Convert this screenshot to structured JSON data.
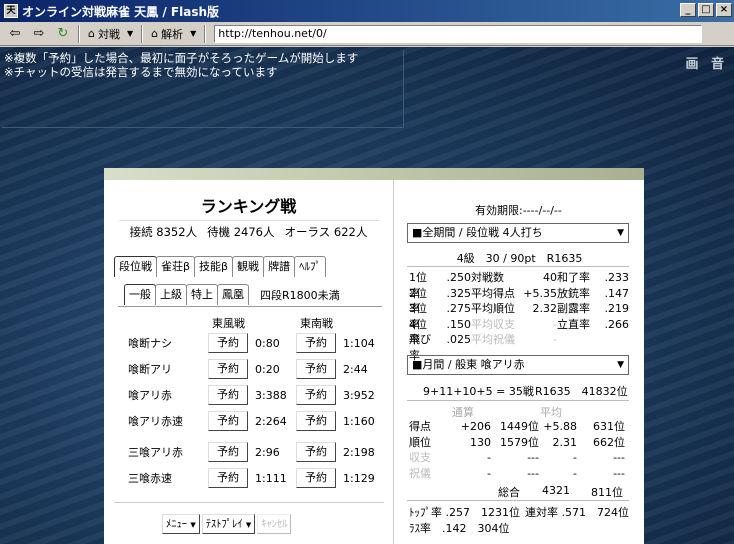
{
  "window": {
    "title": "オンライン対戦麻雀 天鳳 / Flash版",
    "buttons": [
      "_",
      "□",
      "×"
    ]
  },
  "toolbar": {
    "taisen": "対戦",
    "kaiseki": "解析",
    "url": "http://tenhou.net/0/"
  },
  "chat": {
    "line1": "※複数「予約」した場合、最初に面子がそろったゲームが開始します",
    "line2": "※チャットの受信は発言するまで無効になっています"
  },
  "corner": "画 音",
  "lobby": {
    "title": "ランキング戦",
    "connected": "接続 8352人",
    "waiting": "待機 2476人",
    "allLast": "オーラス 622人",
    "tabs": [
      "段位戦",
      "雀荘β",
      "技能β",
      "観戦",
      "牌譜",
      "ﾍﾙﾌﾟ"
    ],
    "subtabs": [
      "一般",
      "上級",
      "特上",
      "鳳凰"
    ],
    "rankReq": "四段R1800未満",
    "col_east": "東風戦",
    "col_south": "東南戦",
    "reserve": "予約",
    "rows": [
      {
        "name": "喰断ナシ",
        "east": "0:80",
        "south": "1:104"
      },
      {
        "name": "喰断アリ",
        "east": "0:20",
        "south": "2:44"
      },
      {
        "name": "喰アリ赤",
        "east": "3:388",
        "south": "3:952"
      },
      {
        "name": "喰アリ赤速",
        "east": "2:264",
        "south": "1:160"
      },
      {
        "name": "三喰アリ赤",
        "east": "2:96",
        "south": "2:198"
      },
      {
        "name": "三喰赤速",
        "east": "1:111",
        "south": "1:129"
      }
    ],
    "menu": "ﾒﾆｭｰ",
    "testplay": "ﾃｽﾄﾌﾟﾚｲ",
    "cancel": "ｷｬﾝｾﾙ"
  },
  "stats": {
    "expiry": "有効期限:----/--/--",
    "period_select": "■全期間 / 段位戦 4人打ち",
    "rank_line": "4級　30 / 90pt　R1635",
    "block1": [
      [
        "1位率",
        ".250",
        "対戦数",
        "40",
        "和了率",
        ".233"
      ],
      [
        "2位率",
        ".325",
        "平均得点",
        "+5.35",
        "放銃率",
        ".147"
      ],
      [
        "3位率",
        ".275",
        "平均順位",
        "2.32",
        "副露率",
        ".219"
      ],
      [
        "4位率",
        ".150",
        "平均収支",
        "-",
        "立直率",
        ".266"
      ],
      [
        "飛び率",
        ".025",
        "平均祝儀",
        "-",
        "",
        ""
      ]
    ],
    "month_select": "■月間 / 般東 喰アリ赤",
    "games_line": "9+11+10+5 = 35戦",
    "rating_line": "R1635　41832位",
    "hdr_total": "通算",
    "hdr_avg": "平均",
    "table": [
      [
        "得点",
        "+206",
        "1449位",
        "+5.88",
        "631位"
      ],
      [
        "順位",
        "130",
        "1579位",
        "2.31",
        "662位"
      ],
      [
        "収支",
        "-",
        "---",
        "-",
        "---"
      ],
      [
        "祝儀",
        "-",
        "---",
        "-",
        "---"
      ]
    ],
    "overall_label": "総合",
    "overall_val": "4321",
    "overall_rank": "811位",
    "top_rate": "ﾄｯﾌﾟ率 .257　1231位",
    "rentai": "連対率 .571　724位",
    "las_rate": "ﾗｽ率　.142　304位"
  }
}
